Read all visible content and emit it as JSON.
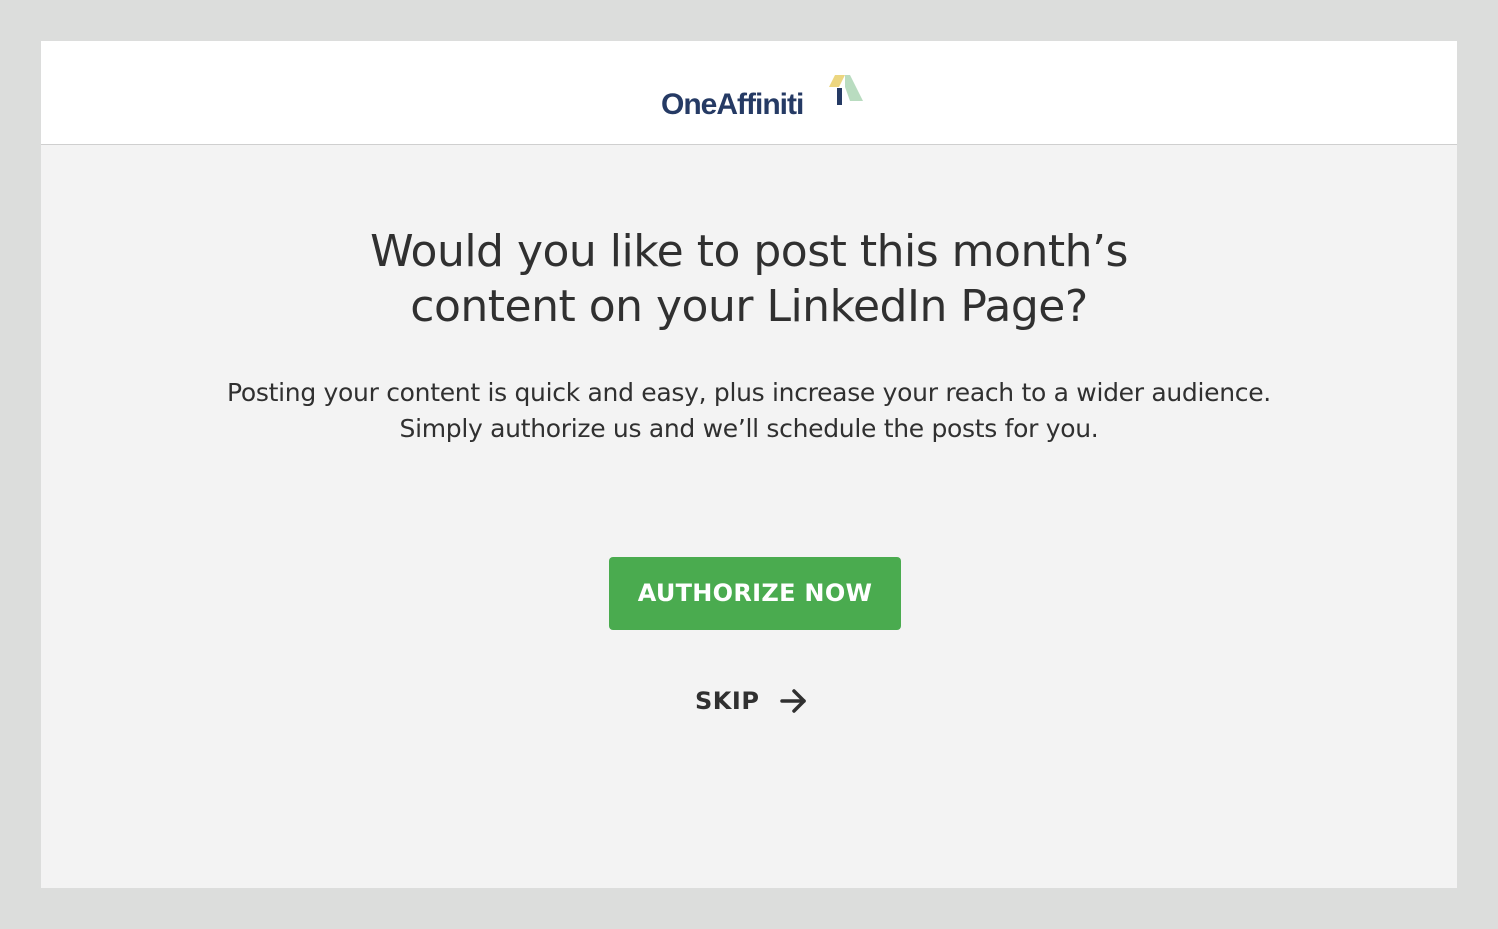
{
  "header": {
    "logo_text": "OneAffiniti",
    "logo_colors": {
      "text": "#253a64",
      "mark_yellow": "#ecd680",
      "mark_navy": "#253a64",
      "mark_green": "#b9dcc0"
    }
  },
  "main": {
    "headline_line1": "Would you like to post this month’s",
    "headline_line2": "content on your LinkedIn Page?",
    "subtext_line1": "Posting your content is quick and easy, plus increase your reach to a wider audience.",
    "subtext_line2": "Simply authorize us and we’ll schedule the posts for you."
  },
  "actions": {
    "authorize_label": "AUTHORIZE NOW",
    "skip_label": "SKIP",
    "skip_icon": "arrow-right-icon",
    "accent_color": "#4aab4f"
  }
}
